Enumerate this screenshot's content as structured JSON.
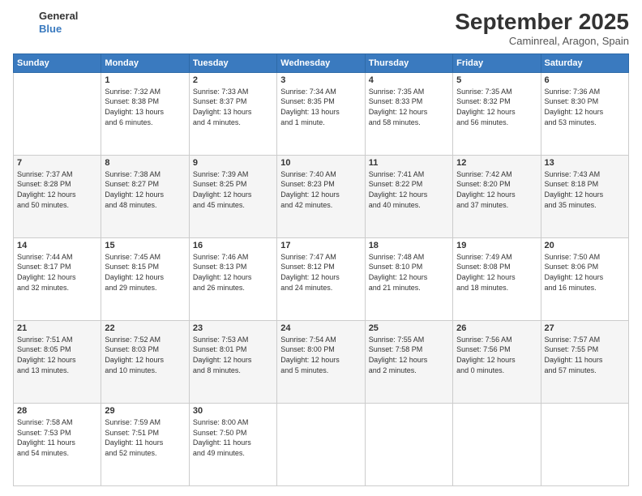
{
  "logo": {
    "line1": "General",
    "line2": "Blue"
  },
  "title": "September 2025",
  "location": "Caminreal, Aragon, Spain",
  "days_of_week": [
    "Sunday",
    "Monday",
    "Tuesday",
    "Wednesday",
    "Thursday",
    "Friday",
    "Saturday"
  ],
  "weeks": [
    [
      {
        "day": "",
        "info": ""
      },
      {
        "day": "1",
        "info": "Sunrise: 7:32 AM\nSunset: 8:38 PM\nDaylight: 13 hours\nand 6 minutes."
      },
      {
        "day": "2",
        "info": "Sunrise: 7:33 AM\nSunset: 8:37 PM\nDaylight: 13 hours\nand 4 minutes."
      },
      {
        "day": "3",
        "info": "Sunrise: 7:34 AM\nSunset: 8:35 PM\nDaylight: 13 hours\nand 1 minute."
      },
      {
        "day": "4",
        "info": "Sunrise: 7:35 AM\nSunset: 8:33 PM\nDaylight: 12 hours\nand 58 minutes."
      },
      {
        "day": "5",
        "info": "Sunrise: 7:35 AM\nSunset: 8:32 PM\nDaylight: 12 hours\nand 56 minutes."
      },
      {
        "day": "6",
        "info": "Sunrise: 7:36 AM\nSunset: 8:30 PM\nDaylight: 12 hours\nand 53 minutes."
      }
    ],
    [
      {
        "day": "7",
        "info": "Sunrise: 7:37 AM\nSunset: 8:28 PM\nDaylight: 12 hours\nand 50 minutes."
      },
      {
        "day": "8",
        "info": "Sunrise: 7:38 AM\nSunset: 8:27 PM\nDaylight: 12 hours\nand 48 minutes."
      },
      {
        "day": "9",
        "info": "Sunrise: 7:39 AM\nSunset: 8:25 PM\nDaylight: 12 hours\nand 45 minutes."
      },
      {
        "day": "10",
        "info": "Sunrise: 7:40 AM\nSunset: 8:23 PM\nDaylight: 12 hours\nand 42 minutes."
      },
      {
        "day": "11",
        "info": "Sunrise: 7:41 AM\nSunset: 8:22 PM\nDaylight: 12 hours\nand 40 minutes."
      },
      {
        "day": "12",
        "info": "Sunrise: 7:42 AM\nSunset: 8:20 PM\nDaylight: 12 hours\nand 37 minutes."
      },
      {
        "day": "13",
        "info": "Sunrise: 7:43 AM\nSunset: 8:18 PM\nDaylight: 12 hours\nand 35 minutes."
      }
    ],
    [
      {
        "day": "14",
        "info": "Sunrise: 7:44 AM\nSunset: 8:17 PM\nDaylight: 12 hours\nand 32 minutes."
      },
      {
        "day": "15",
        "info": "Sunrise: 7:45 AM\nSunset: 8:15 PM\nDaylight: 12 hours\nand 29 minutes."
      },
      {
        "day": "16",
        "info": "Sunrise: 7:46 AM\nSunset: 8:13 PM\nDaylight: 12 hours\nand 26 minutes."
      },
      {
        "day": "17",
        "info": "Sunrise: 7:47 AM\nSunset: 8:12 PM\nDaylight: 12 hours\nand 24 minutes."
      },
      {
        "day": "18",
        "info": "Sunrise: 7:48 AM\nSunset: 8:10 PM\nDaylight: 12 hours\nand 21 minutes."
      },
      {
        "day": "19",
        "info": "Sunrise: 7:49 AM\nSunset: 8:08 PM\nDaylight: 12 hours\nand 18 minutes."
      },
      {
        "day": "20",
        "info": "Sunrise: 7:50 AM\nSunset: 8:06 PM\nDaylight: 12 hours\nand 16 minutes."
      }
    ],
    [
      {
        "day": "21",
        "info": "Sunrise: 7:51 AM\nSunset: 8:05 PM\nDaylight: 12 hours\nand 13 minutes."
      },
      {
        "day": "22",
        "info": "Sunrise: 7:52 AM\nSunset: 8:03 PM\nDaylight: 12 hours\nand 10 minutes."
      },
      {
        "day": "23",
        "info": "Sunrise: 7:53 AM\nSunset: 8:01 PM\nDaylight: 12 hours\nand 8 minutes."
      },
      {
        "day": "24",
        "info": "Sunrise: 7:54 AM\nSunset: 8:00 PM\nDaylight: 12 hours\nand 5 minutes."
      },
      {
        "day": "25",
        "info": "Sunrise: 7:55 AM\nSunset: 7:58 PM\nDaylight: 12 hours\nand 2 minutes."
      },
      {
        "day": "26",
        "info": "Sunrise: 7:56 AM\nSunset: 7:56 PM\nDaylight: 12 hours\nand 0 minutes."
      },
      {
        "day": "27",
        "info": "Sunrise: 7:57 AM\nSunset: 7:55 PM\nDaylight: 11 hours\nand 57 minutes."
      }
    ],
    [
      {
        "day": "28",
        "info": "Sunrise: 7:58 AM\nSunset: 7:53 PM\nDaylight: 11 hours\nand 54 minutes."
      },
      {
        "day": "29",
        "info": "Sunrise: 7:59 AM\nSunset: 7:51 PM\nDaylight: 11 hours\nand 52 minutes."
      },
      {
        "day": "30",
        "info": "Sunrise: 8:00 AM\nSunset: 7:50 PM\nDaylight: 11 hours\nand 49 minutes."
      },
      {
        "day": "",
        "info": ""
      },
      {
        "day": "",
        "info": ""
      },
      {
        "day": "",
        "info": ""
      },
      {
        "day": "",
        "info": ""
      }
    ]
  ]
}
